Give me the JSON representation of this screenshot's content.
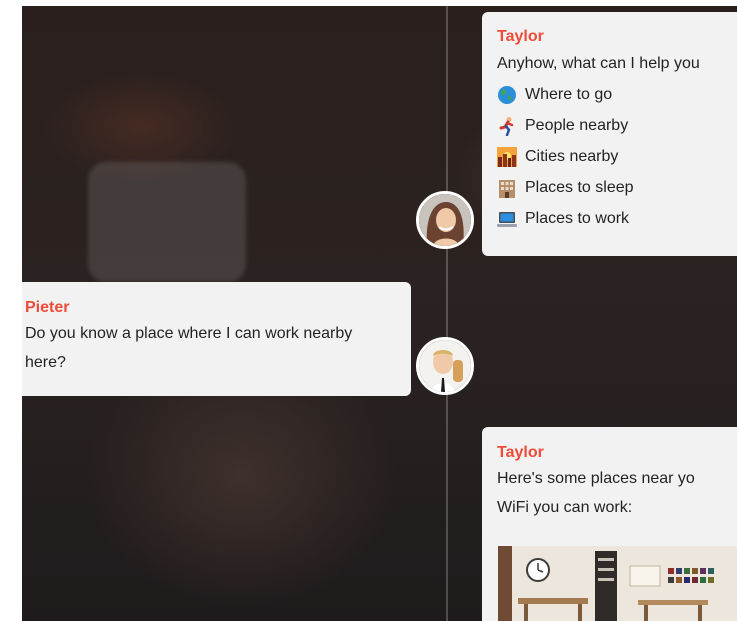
{
  "chat": {
    "messages": [
      {
        "sender": "Taylor",
        "text": "Anyhow, what can I help you",
        "options": [
          {
            "icon": "globe-icon",
            "label": "Where to go"
          },
          {
            "icon": "running-person-icon",
            "label": "People nearby"
          },
          {
            "icon": "city-icon",
            "label": "Cities nearby"
          },
          {
            "icon": "hotel-icon",
            "label": "Places to sleep"
          },
          {
            "icon": "laptop-icon",
            "label": "Places to work"
          }
        ]
      },
      {
        "sender": "Pieter",
        "text": "Do you know a place where I can work nearby here?"
      },
      {
        "sender": "Taylor",
        "line1": "Here's some places near yo",
        "line2": "WiFi you can work:"
      }
    ]
  },
  "colors": {
    "accent": "#ee4b39",
    "bubble": "#f2f2f2",
    "text": "#232323"
  }
}
